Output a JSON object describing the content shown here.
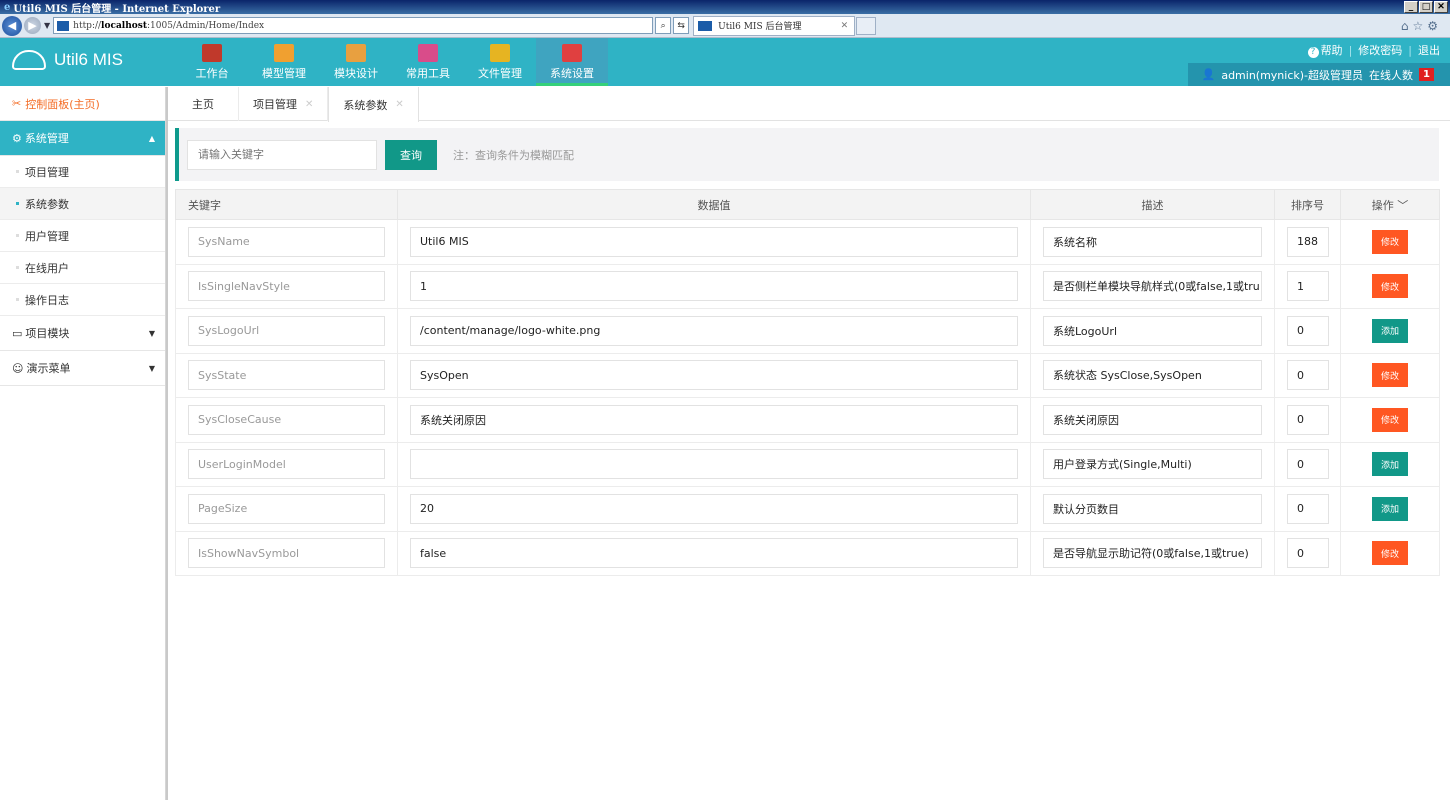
{
  "browser": {
    "window_title": "Util6 MIS 后台管理 - Internet Explorer",
    "url_prefix": "http://",
    "url_host": "localhost",
    "url_rest": ":1005/Admin/Home/Index",
    "tab_title": "Util6 MIS 后台管理"
  },
  "header": {
    "app_name": "Util6 MIS",
    "modules": [
      {
        "label": "工作台",
        "color": "#c0392b"
      },
      {
        "label": "模型管理",
        "color": "#f0a030"
      },
      {
        "label": "模块设计",
        "color": "#e8a040"
      },
      {
        "label": "常用工具",
        "color": "#d94c8a"
      },
      {
        "label": "文件管理",
        "color": "#e6b422"
      },
      {
        "label": "系统设置",
        "color": "#e04040"
      }
    ],
    "links": {
      "help": "帮助",
      "change_password": "修改密码",
      "logout": "退出"
    },
    "user": "admin(mynick)-超级管理员",
    "online_label": "在线人数",
    "online_count": "1"
  },
  "sidebar": {
    "dashboard": "控制面板(主页)",
    "groups": [
      {
        "label": "系统管理",
        "items": [
          "项目管理",
          "系统参数",
          "用户管理",
          "在线用户",
          "操作日志"
        ]
      },
      {
        "label": "项目模块"
      },
      {
        "label": "演示菜单"
      }
    ]
  },
  "tabs": [
    "主页",
    "项目管理",
    "系统参数"
  ],
  "search": {
    "placeholder": "请输入关键字",
    "button": "查询",
    "note": "注：查询条件为模糊匹配"
  },
  "table": {
    "headers": [
      "关键字",
      "数据值",
      "描述",
      "排序号",
      "操作"
    ],
    "rows": [
      {
        "key": "SysName",
        "value": "Util6 MIS",
        "desc": "系统名称",
        "sort": "188",
        "action": "修改",
        "type": "edit"
      },
      {
        "key": "IsSingleNavStyle",
        "value": "1",
        "desc": "是否侧栏单模块导航样式(0或false,1或tru",
        "sort": "1",
        "action": "修改",
        "type": "edit"
      },
      {
        "key": "SysLogoUrl",
        "value": "/content/manage/logo-white.png",
        "desc": "系统LogoUrl",
        "sort": "0",
        "action": "添加",
        "type": "add"
      },
      {
        "key": "SysState",
        "value": "SysOpen",
        "desc": "系统状态 SysClose,SysOpen",
        "sort": "0",
        "action": "修改",
        "type": "edit"
      },
      {
        "key": "SysCloseCause",
        "value": "系统关闭原因",
        "desc": "系统关闭原因",
        "sort": "0",
        "action": "修改",
        "type": "edit"
      },
      {
        "key": "UserLoginModel",
        "value": "",
        "desc": "用户登录方式(Single,Multi)",
        "sort": "0",
        "action": "添加",
        "type": "add"
      },
      {
        "key": "PageSize",
        "value": "20",
        "desc": "默认分页数目",
        "sort": "0",
        "action": "添加",
        "type": "add"
      },
      {
        "key": "IsShowNavSymbol",
        "value": "false",
        "desc": "是否导航显示助记符(0或false,1或true)",
        "sort": "0",
        "action": "修改",
        "type": "edit"
      }
    ]
  }
}
